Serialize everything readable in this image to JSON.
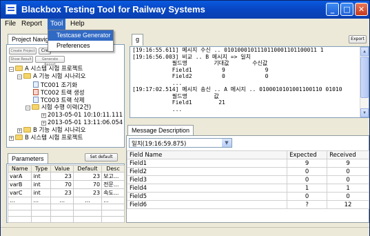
{
  "window": {
    "title": "Blackbox Testing Tool for Railway Systems"
  },
  "menu": {
    "items": [
      "File",
      "Report",
      "Tool",
      "Help"
    ],
    "tool_dropdown": [
      "Testcase Generator",
      "Preferences"
    ]
  },
  "project_nav": {
    "tab_label": "Project Navig",
    "btn_create_project": "Create Project",
    "btn_cre": "Cre",
    "btn_show_result": "Show Result",
    "btn_generate_report": "Generate Report",
    "tree": [
      "A 시스템 시험 프로젝트",
      "A 기능 시험 시나리오",
      "TC001 조기화",
      "TC002 트랙 생성",
      "TC003 트랙 삭제",
      "시험 수행 이력(2건)",
      "2013-05-01 10:10:11.111",
      "2013-05-01 13:11:06.054",
      "B 기능 시험 시나리오",
      "B 시스템 시험 프로젝트"
    ]
  },
  "parameters": {
    "tab_label": "Parameters",
    "set_default_label": "Set default",
    "columns": [
      "Name",
      "Type",
      "Value",
      "Default",
      "Desc"
    ],
    "rows": [
      [
        "varA",
        "int",
        "23",
        "23",
        "보고..."
      ],
      [
        "varB",
        "int",
        "70",
        "70",
        "전문..."
      ],
      [
        "varC",
        "int",
        "23",
        "23",
        "속도..."
      ],
      [
        "...",
        "...",
        "...",
        "...",
        "..."
      ]
    ]
  },
  "log_panel": {
    "tab_label": "g",
    "export_label": "Export",
    "lines": [
      "[19:16:55.611] 메시지 수신 .. 0101000101110110001101100011 1",
      "[19:16:56.003] 비교 .. B 메시지 => 일치",
      "            필드명        기대값       수신값",
      "            Field1         9            9",
      "            Field2         0            0",
      "            ...",
      "[19:17:02.514] 메시지 송신 .. A 메시지 .. 0100010101001100110 01010",
      "            필드명        값",
      "            Field1        21",
      "            ..."
    ]
  },
  "message_description": {
    "tab_label": "Message Description",
    "selected": "일치(19:16:59.875)",
    "columns": [
      "Field Name",
      "Expected",
      "Received"
    ],
    "rows": [
      [
        "Field1",
        "9",
        "9"
      ],
      [
        "Field2",
        "0",
        "0"
      ],
      [
        "Field3",
        "0",
        "0"
      ],
      [
        "Field4",
        "1",
        "1"
      ],
      [
        "Field5",
        "0",
        "0"
      ],
      [
        "Field6",
        "?",
        "12"
      ]
    ]
  }
}
